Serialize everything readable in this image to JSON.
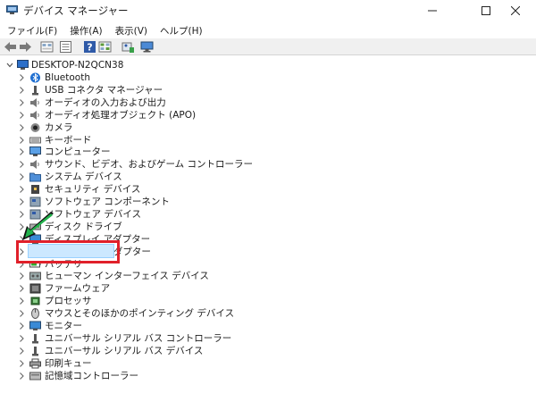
{
  "window": {
    "title": "デバイス マネージャー"
  },
  "menu": [
    "ファイル(F)",
    "操作(A)",
    "表示(V)",
    "ヘルプ(H)"
  ],
  "toolbar": [
    "back",
    "forward",
    "show-hidden",
    "properties",
    "help",
    "view",
    "scan",
    "monitor"
  ],
  "tree": {
    "root": "DESKTOP-N2QCN38",
    "items": [
      {
        "label": "Bluetooth",
        "icon": "bluetooth-icon"
      },
      {
        "label": "USB コネクタ マネージャー",
        "icon": "usb-icon"
      },
      {
        "label": "オーディオの入力および出力",
        "icon": "speaker-icon"
      },
      {
        "label": "オーディオ処理オブジェクト (APO)",
        "icon": "speaker-icon"
      },
      {
        "label": "カメラ",
        "icon": "camera-icon"
      },
      {
        "label": "キーボード",
        "icon": "keyboard-icon"
      },
      {
        "label": "コンピューター",
        "icon": "computer-icon"
      },
      {
        "label": "サウンド、ビデオ、およびゲーム コントローラー",
        "icon": "speaker-icon"
      },
      {
        "label": "システム デバイス",
        "icon": "folder-icon"
      },
      {
        "label": "セキュリティ デバイス",
        "icon": "security-icon"
      },
      {
        "label": "ソフトウェア コンポーネント",
        "icon": "component-icon"
      },
      {
        "label": "ソフトウェア デバイス",
        "icon": "component-icon"
      },
      {
        "label": "ディスク ドライブ",
        "icon": "disk-icon"
      },
      {
        "label": "ディスプレイ アダプター",
        "icon": "display-icon"
      },
      {
        "label": "ネットワーク アダプター",
        "icon": "network-icon"
      },
      {
        "label": "バッテリ",
        "icon": "battery-icon"
      },
      {
        "label": "ヒューマン インターフェイス デバイス",
        "icon": "hid-icon"
      },
      {
        "label": "ファームウェア",
        "icon": "firmware-icon"
      },
      {
        "label": "プロセッサ",
        "icon": "processor-icon"
      },
      {
        "label": "マウスとそのほかのポインティング デバイス",
        "icon": "mouse-icon"
      },
      {
        "label": "モニター",
        "icon": "monitor-icon"
      },
      {
        "label": "ユニバーサル シリアル バス コントローラー",
        "icon": "usb-icon"
      },
      {
        "label": "ユニバーサル シリアル バス デバイス",
        "icon": "usb-icon"
      },
      {
        "label": "印刷キュー",
        "icon": "printer-icon"
      },
      {
        "label": "記憶域コントローラー",
        "icon": "storage-icon"
      }
    ]
  },
  "highlight": {
    "item": "ネットワーク アダプター",
    "box_color": "#e0202a",
    "arrow_color": "#22b14c"
  }
}
